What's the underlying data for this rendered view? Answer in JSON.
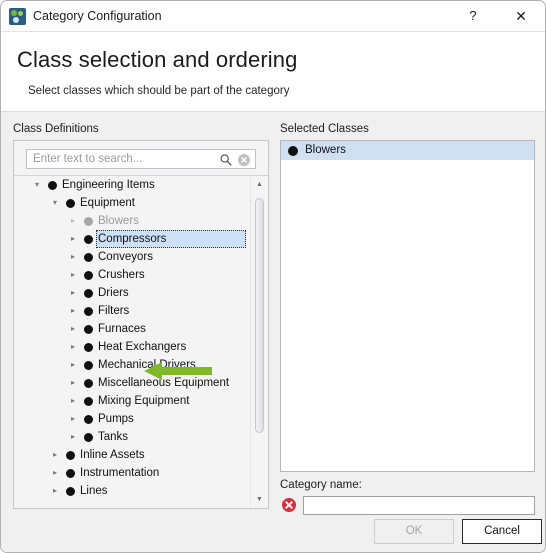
{
  "window": {
    "title": "Category Configuration",
    "app_icon": "category-app-icon",
    "help_label": "?",
    "close_label": "✕"
  },
  "header": {
    "heading": "Class selection and ordering",
    "subheading": "Select classes which should be part of the category"
  },
  "left": {
    "section_label": "Class Definitions",
    "search": {
      "placeholder": "Enter text to search...",
      "value": "",
      "search_icon": "magnifier-icon",
      "clear_icon": "clear-circle-icon"
    },
    "tree": [
      {
        "label": "Engineering Items",
        "depth": 1,
        "expander": "▾",
        "state": "expanded"
      },
      {
        "label": "Equipment",
        "depth": 2,
        "expander": "▾",
        "state": "expanded"
      },
      {
        "label": "Blowers",
        "depth": 3,
        "expander": "▸",
        "state": "dimmed"
      },
      {
        "label": "Compressors",
        "depth": 3,
        "expander": "▸",
        "state": "selected"
      },
      {
        "label": "Conveyors",
        "depth": 3,
        "expander": "▸",
        "state": "normal"
      },
      {
        "label": "Crushers",
        "depth": 3,
        "expander": "▸",
        "state": "normal"
      },
      {
        "label": "Driers",
        "depth": 3,
        "expander": "▸",
        "state": "normal"
      },
      {
        "label": "Filters",
        "depth": 3,
        "expander": "▸",
        "state": "normal"
      },
      {
        "label": "Furnaces",
        "depth": 3,
        "expander": "▸",
        "state": "normal"
      },
      {
        "label": "Heat Exchangers",
        "depth": 3,
        "expander": "▸",
        "state": "normal"
      },
      {
        "label": "Mechanical Drivers",
        "depth": 3,
        "expander": "▸",
        "state": "normal"
      },
      {
        "label": "Miscellaneous Equipment",
        "depth": 3,
        "expander": "▸",
        "state": "normal"
      },
      {
        "label": "Mixing Equipment",
        "depth": 3,
        "expander": "▸",
        "state": "normal"
      },
      {
        "label": "Pumps",
        "depth": 3,
        "expander": "▸",
        "state": "normal"
      },
      {
        "label": "Tanks",
        "depth": 3,
        "expander": "▸",
        "state": "normal"
      },
      {
        "label": "Inline Assets",
        "depth": 2,
        "expander": "▸",
        "state": "normal"
      },
      {
        "label": "Instrumentation",
        "depth": 2,
        "expander": "▸",
        "state": "normal"
      },
      {
        "label": "Lines",
        "depth": 2,
        "expander": "▸",
        "state": "normal"
      }
    ],
    "scrollbar": {
      "up_arrow": "▲",
      "down_arrow": "▼"
    }
  },
  "right": {
    "section_label": "Selected Classes",
    "items": [
      {
        "label": "Blowers",
        "state": "selected"
      }
    ]
  },
  "category": {
    "label": "Category name:",
    "value": "",
    "placeholder": "",
    "error_icon": "error-circle-icon"
  },
  "footer": {
    "ok_label": "OK",
    "ok_enabled": false,
    "cancel_label": "Cancel",
    "cancel_enabled": true
  },
  "annotation": {
    "type": "left-arrow",
    "color": "#7db928",
    "points_at": "Blowers"
  },
  "colors": {
    "accent_selection": "#cce1f6",
    "list_selection": "#cfe0f3",
    "annotation_green": "#7db928",
    "error_red": "#d32f3c",
    "window_bg": "#f0f0f0"
  }
}
